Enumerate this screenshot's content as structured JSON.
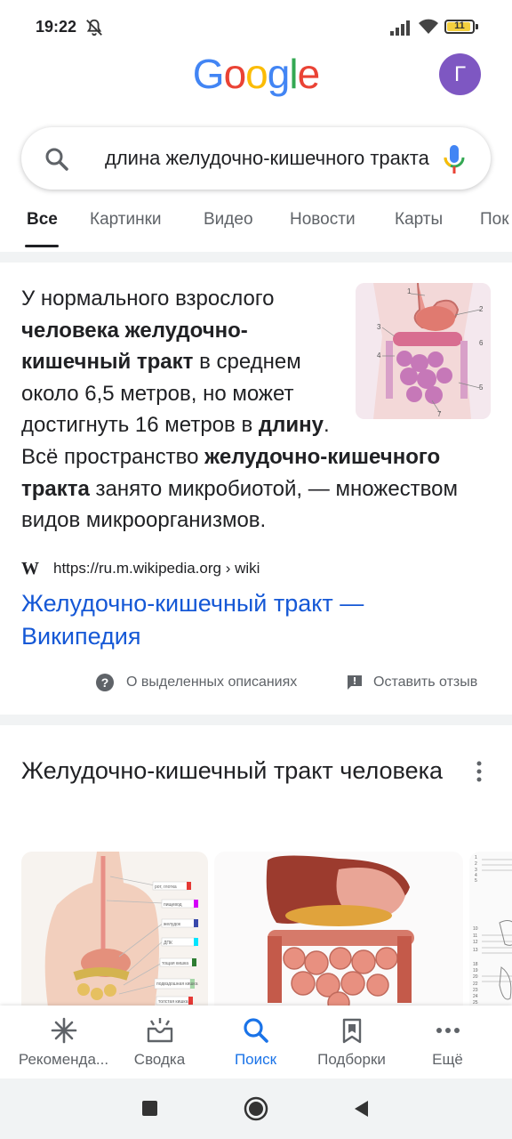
{
  "status_bar": {
    "time": "19:22",
    "battery_level": "11",
    "icons": [
      "mute-icon",
      "signal-icon",
      "wifi-icon",
      "battery-icon"
    ]
  },
  "header": {
    "logo_letters": [
      "G",
      "o",
      "o",
      "g",
      "l",
      "e"
    ],
    "logo_colors": [
      "#4285F4",
      "#EA4335",
      "#FBBC05",
      "#4285F4",
      "#34A853",
      "#EA4335"
    ],
    "avatar_letter": "Г",
    "avatar_color": "#7e57c2"
  },
  "search": {
    "query": "длина желудочно-кишечного тракта"
  },
  "tabs": [
    {
      "label": "Все",
      "active": true
    },
    {
      "label": "Картинки",
      "active": false
    },
    {
      "label": "Видео",
      "active": false
    },
    {
      "label": "Новости",
      "active": false
    },
    {
      "label": "Карты",
      "active": false
    },
    {
      "label": "Пок",
      "active": false
    }
  ],
  "snippet": {
    "parts": [
      {
        "text": "У нормального взрослого ",
        "bold": false
      },
      {
        "text": "человека желудочно-кишечный тракт",
        "bold": true
      },
      {
        "text": " в среднем около 6,5 метров, но может достигнуть 16 метров в ",
        "bold": false
      },
      {
        "text": "длину",
        "bold": true
      },
      {
        "text": ". Всё пространство ",
        "bold": false
      },
      {
        "text": "желудочно-кишечного тракта",
        "bold": true
      },
      {
        "text": " занято микробиотой, — множеством видов микроорганизмов.",
        "bold": false
      }
    ],
    "image_labels": [
      "1",
      "2",
      "3",
      "4",
      "5",
      "6",
      "7"
    ],
    "source_icon": "W",
    "source_url": "https://ru.m.wikipedia.org › wiki",
    "link_title": "Желудочно-кишечный тракт — Википедия",
    "link_color": "#1558d6",
    "about_label": "О выделенных описаниях",
    "feedback_label": "Оставить отзыв"
  },
  "images_section": {
    "title": "Желудочно-кишечный тракт человека",
    "image1_labels": [
      "рот, глотка",
      "пищевод",
      "желудок",
      "ДПК",
      "тощая кишка",
      "подвздошная кишка",
      "толстая кишка"
    ],
    "image3_labels": [
      "1",
      "2",
      "3",
      "4",
      "5",
      "10",
      "11",
      "12",
      "13",
      "18",
      "19",
      "20",
      "22",
      "23",
      "24",
      "25"
    ]
  },
  "bottom_nav": [
    {
      "label": "Рекоменда...",
      "icon": "asterisk-icon",
      "active": false
    },
    {
      "label": "Сводка",
      "icon": "inbox-icon",
      "active": false
    },
    {
      "label": "Поиск",
      "icon": "search-icon",
      "active": true
    },
    {
      "label": "Подборки",
      "icon": "collections-icon",
      "active": false
    },
    {
      "label": "Ещё",
      "icon": "more-horiz-icon",
      "active": false
    }
  ],
  "accent_color": "#1a73e8"
}
